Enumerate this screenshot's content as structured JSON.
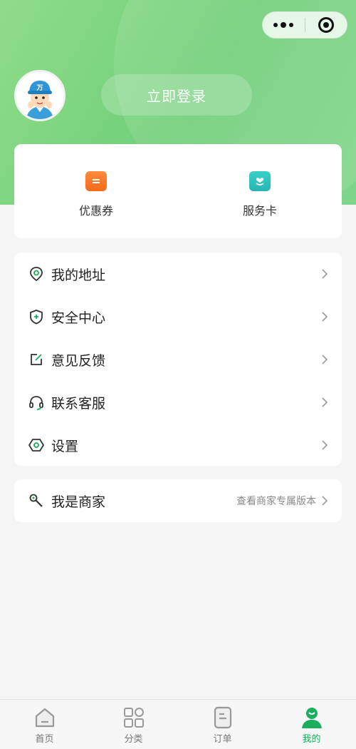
{
  "header": {
    "menu_icon": "more-dots-icon",
    "close_icon": "capsule-target-icon",
    "login_label": "立即登录",
    "avatar_icon": "worker-avatar",
    "avatar_badge": "万"
  },
  "quick_links": [
    {
      "label": "优惠券",
      "icon": "coupon-icon",
      "color": "#f36a1a"
    },
    {
      "label": "服务卡",
      "icon": "service-card-icon",
      "color": "#27b5b5"
    }
  ],
  "menu": [
    {
      "label": "我的地址",
      "icon": "location-pin-icon"
    },
    {
      "label": "安全中心",
      "icon": "shield-icon"
    },
    {
      "label": "意见反馈",
      "icon": "edit-icon"
    },
    {
      "label": "联系客服",
      "icon": "headset-icon"
    },
    {
      "label": "设置",
      "icon": "settings-hex-icon"
    }
  ],
  "merchant": {
    "label": "我是商家",
    "sub_label": "查看商家专属版本",
    "icon": "wrench-icon"
  },
  "tabbar": [
    {
      "label": "首页",
      "icon": "home-icon",
      "active": false
    },
    {
      "label": "分类",
      "icon": "category-icon",
      "active": false
    },
    {
      "label": "订单",
      "icon": "order-icon",
      "active": false
    },
    {
      "label": "我的",
      "icon": "profile-icon",
      "active": true
    }
  ],
  "colors": {
    "brand": "#1aae5e",
    "hero_start": "#8fdc8a",
    "hero_end": "#6fcf78",
    "icon_accent": "#1aae5e"
  }
}
